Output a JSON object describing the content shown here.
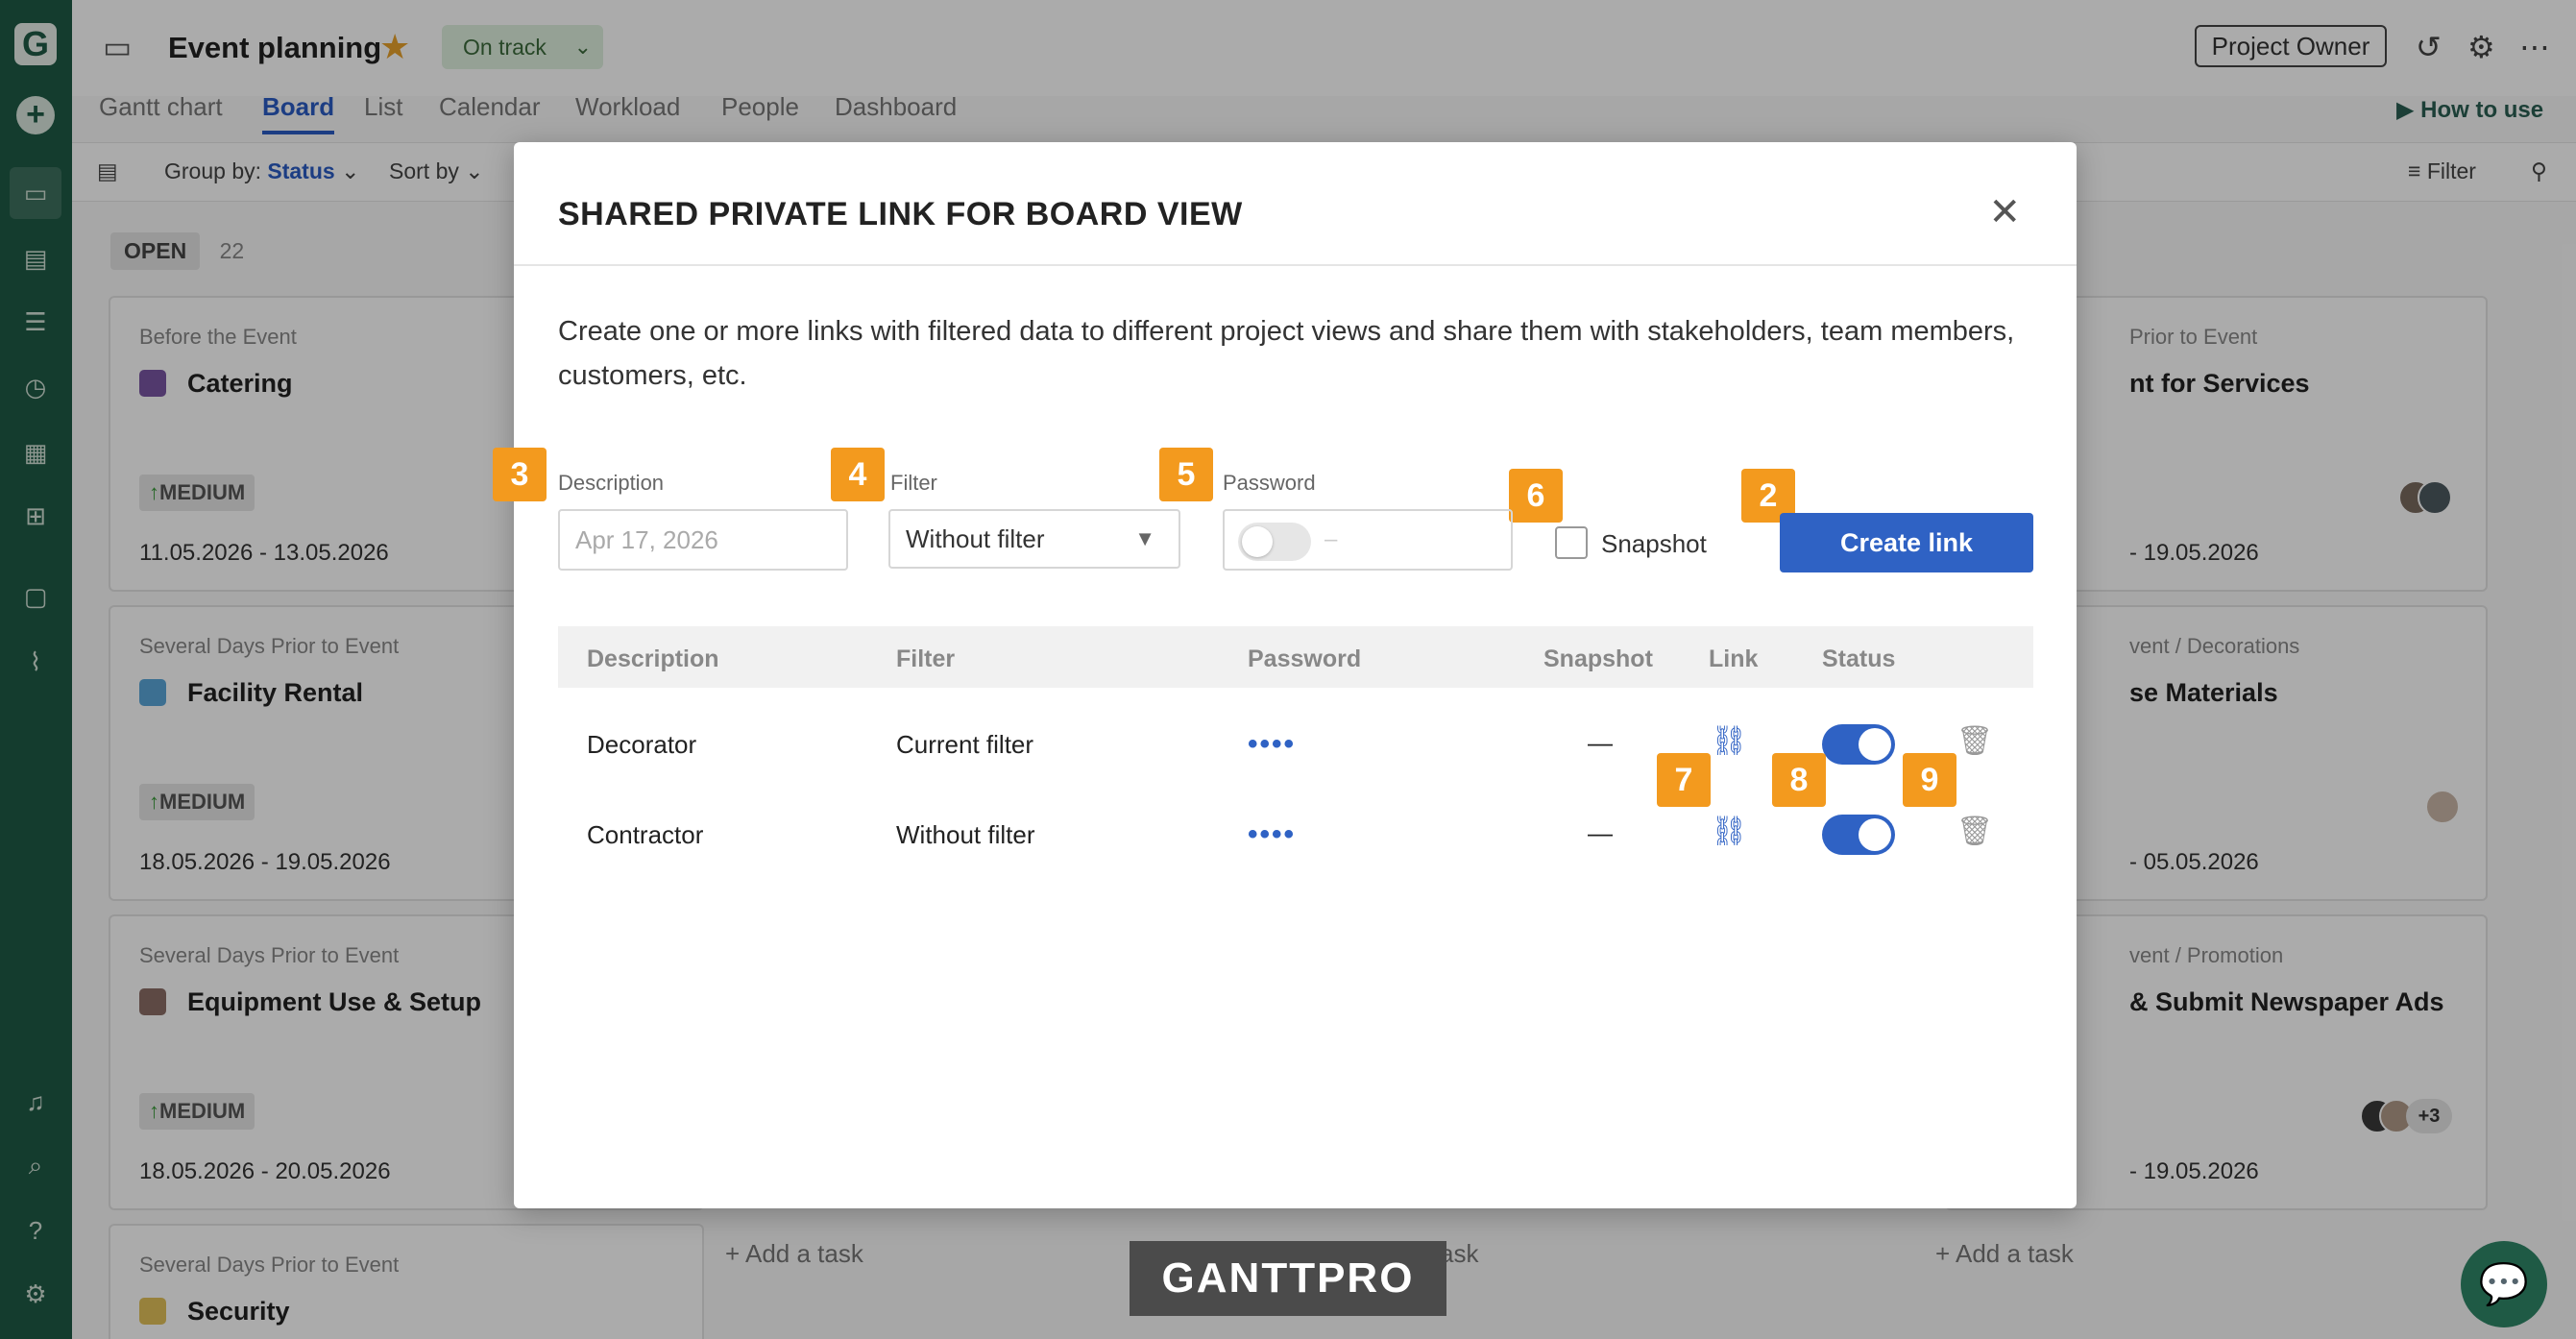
{
  "project": {
    "title": "Event planning",
    "status": "On track",
    "owner": "Project Owner"
  },
  "tabs": [
    "Gantt chart",
    "Board",
    "List",
    "Calendar",
    "Workload",
    "People",
    "Dashboard"
  ],
  "how_to_use": "How to use",
  "toolbar": {
    "group_by_label": "Group by:",
    "group_by_value": "Status",
    "sort_by": "Sort by",
    "filter": "Filter"
  },
  "board": {
    "column": "OPEN",
    "count": "22",
    "cards": [
      {
        "group": "Before the Event",
        "name": "Catering",
        "color": "#7a56a3",
        "priority": "MEDIUM",
        "dates": "11.05.2026  -  13.05.2026"
      },
      {
        "group": "Several Days Prior to Event",
        "name": "Facility Rental",
        "color": "#5aa6d8",
        "priority": "MEDIUM",
        "dates": "18.05.2026  -  19.05.2026"
      },
      {
        "group": "Several Days Prior to Event",
        "name": "Equipment Use & Setup",
        "color": "#8b6e66",
        "priority": "MEDIUM",
        "dates": "18.05.2026  -  20.05.2026"
      },
      {
        "group": "Several Days Prior to Event",
        "name": "Security",
        "color": "#e2c15a"
      }
    ],
    "right_cards": [
      {
        "group": "Prior to Event",
        "name": "nt for Services",
        "dates": "-  19.05.2026"
      },
      {
        "group": "vent / Decorations",
        "name": "se Materials",
        "dates": "-  05.05.2026"
      },
      {
        "group": "vent / Promotion",
        "name": "& Submit Newspaper Ads",
        "dates": "-  19.05.2026",
        "extra": "+3"
      }
    ],
    "add_task": "Add a task",
    "add_task_short": "ask"
  },
  "modal": {
    "title": "SHARED PRIVATE LINK FOR BOARD VIEW",
    "description": "Create one or more links with filtered data to different project views and share them with stakeholders, team members, customers, etc.",
    "fields": {
      "description_label": "Description",
      "description_placeholder": "Apr 17, 2026",
      "filter_label": "Filter",
      "filter_value": "Without filter",
      "password_label": "Password",
      "password_dash": "–",
      "snapshot_label": "Snapshot",
      "create_button": "Create link"
    },
    "table": {
      "headers": [
        "Description",
        "Filter",
        "Password",
        "Snapshot",
        "Link",
        "Status"
      ],
      "rows": [
        {
          "description": "Decorator",
          "filter": "Current filter",
          "password": "••••",
          "snapshot": "—"
        },
        {
          "description": "Contractor",
          "filter": "Without filter",
          "password": "••••",
          "snapshot": "—"
        }
      ]
    },
    "badges": [
      "3",
      "4",
      "5",
      "6",
      "2",
      "7",
      "8",
      "9"
    ]
  },
  "watermark": "GANTTPRO"
}
